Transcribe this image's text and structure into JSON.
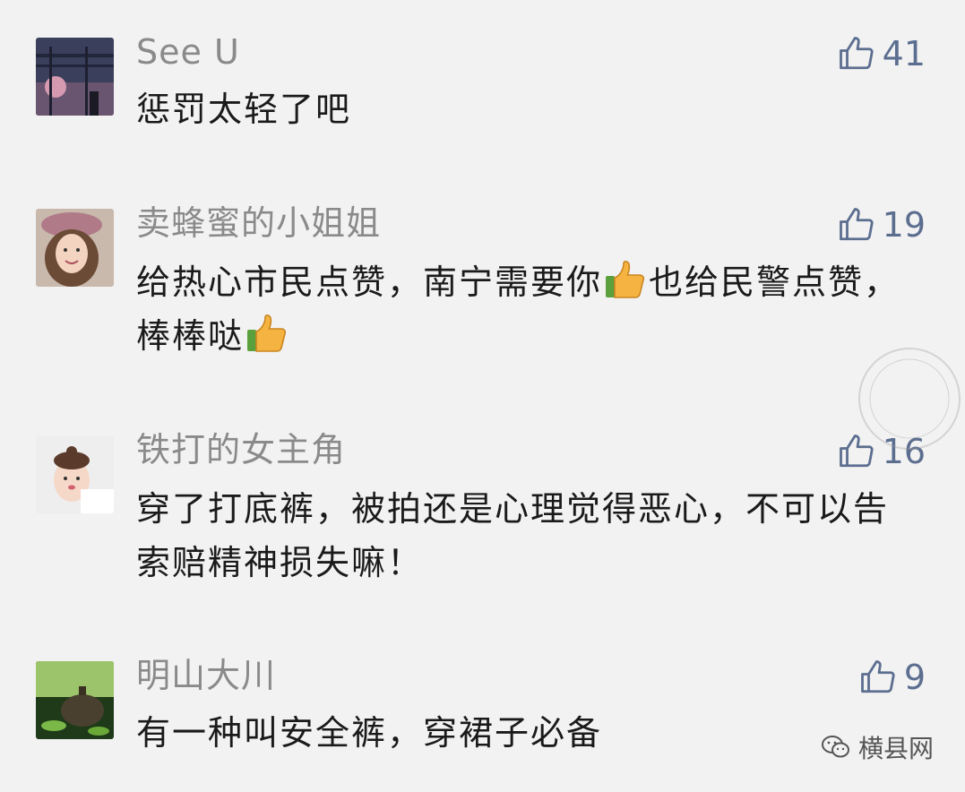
{
  "comments": [
    {
      "name": "See U",
      "text": "惩罚太轻了吧",
      "likes": "41",
      "avatar_icon": "bridge-photo"
    },
    {
      "name": "卖蜂蜜的小姐姐",
      "text_a": "给热心市民点赞，南宁需要你",
      "text_b": "也给民警点赞，棒棒哒",
      "likes": "19",
      "avatar_icon": "woman-hat-photo"
    },
    {
      "name": "铁打的女主角",
      "text": "穿了打底裤，被拍还是心理觉得恶心，不可以告索赔精神损失嘛！",
      "likes": "16",
      "avatar_icon": "baby-photo"
    },
    {
      "name": "明山大川",
      "text": "有一种叫安全裤，穿裙子必备",
      "likes": "9",
      "avatar_icon": "teapot-photo"
    }
  ],
  "watermark": {
    "label": "横县网",
    "icon": "wechat-icon",
    "seal_text": "横县网"
  },
  "colors": {
    "background": "#f2f2f2",
    "name": "#8a8a8a",
    "like": "#5c6e90",
    "text": "#1a1a1a"
  }
}
